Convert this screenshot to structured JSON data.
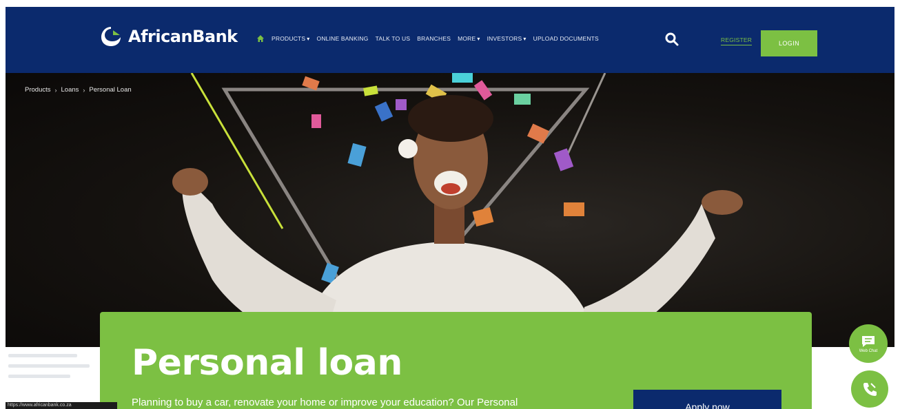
{
  "header": {
    "brand": "AfricanBank",
    "nav": [
      {
        "label": "PRODUCTS",
        "has_menu": true
      },
      {
        "label": "ONLINE BANKING",
        "has_menu": false
      },
      {
        "label": "TALK TO US",
        "has_menu": false
      },
      {
        "label": "BRANCHES",
        "has_menu": false
      },
      {
        "label": "MORE",
        "has_menu": true
      },
      {
        "label": "INVESTORS",
        "has_menu": true
      },
      {
        "label": "UPLOAD DOCUMENTS",
        "has_menu": false
      }
    ],
    "register_label": "REGISTER",
    "login_label": "LOGIN",
    "icons": {
      "home": "home-icon",
      "search": "search-icon",
      "chevron": "chevron-down-icon"
    }
  },
  "breadcrumb": [
    "Products",
    "Loans",
    "Personal Loan"
  ],
  "hero": {
    "title": "Personal loan",
    "description": "Planning to buy a car, renovate your home or improve your education? Our Personal",
    "apply_label": "Apply now"
  },
  "floating": {
    "chat_label": "Web Chat",
    "chat_icon": "chat-icon",
    "call_icon": "phone-icon"
  },
  "status_bar": {
    "url": "https://www.africanbank.co.za"
  },
  "colors": {
    "navy": "#0b2a6d",
    "green": "#7cc043",
    "white": "#ffffff"
  }
}
